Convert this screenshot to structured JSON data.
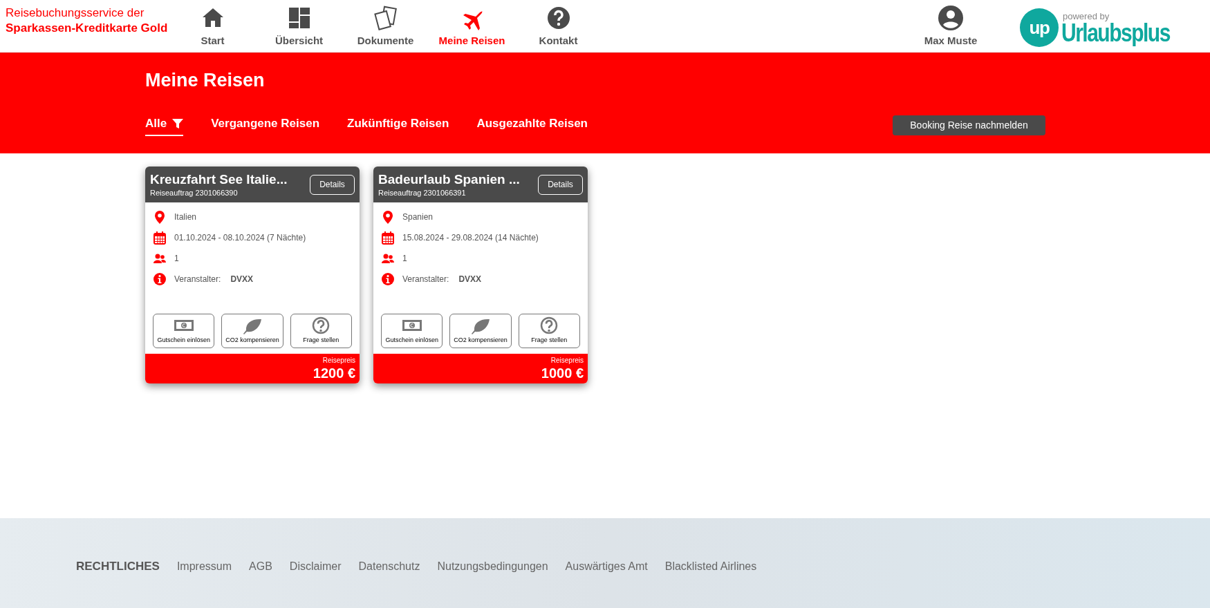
{
  "brand": {
    "line_1": "Reisebuchungsservice der",
    "line_2": "Sparkassen-Kreditkarte Gold"
  },
  "nav": [
    {
      "label": "Start",
      "kind": "house",
      "selected": false
    },
    {
      "label": "Übersicht",
      "kind": "grid",
      "selected": false
    },
    {
      "label": "Dokumente",
      "kind": "documents",
      "selected": false
    },
    {
      "label": "Meine Reisen",
      "kind": "plane",
      "selected": true
    },
    {
      "label": "Kontakt",
      "kind": "question",
      "selected": false
    }
  ],
  "user": {
    "name": "Max Muste"
  },
  "logo": {
    "powered_by": "powered by",
    "badge": "up",
    "name": "Urlaubsplus"
  },
  "page_title": "Meine Reisen",
  "filter_tabs": [
    {
      "label": "Alle",
      "filter_icon": true,
      "selected": true
    },
    {
      "label": "Vergangene Reisen",
      "filter_icon": false,
      "selected": false
    },
    {
      "label": "Zukünftige Reisen",
      "filter_icon": false,
      "selected": false
    },
    {
      "label": "Ausgezahlte Reisen",
      "filter_icon": false,
      "selected": false
    }
  ],
  "report_button": "Booking Reise nachmelden",
  "trips": [
    {
      "title": "Kreuzfahrt See Italie...",
      "order": "Reiseauftrag 2301066390",
      "details_button": "Details",
      "destination": "Italien",
      "dates": "01.10.2024 - 08.10.2024 (7 Nächte)",
      "travellers": "1",
      "organizer_label": "Veranstalter:",
      "organizer": "DVXX",
      "actions": [
        {
          "label": "Gutschein einlösen",
          "kind": "banknote"
        },
        {
          "label": "CO2 kompensieren",
          "kind": "leaf"
        },
        {
          "label": "Frage stellen",
          "kind": "question"
        }
      ],
      "price_label": "Reisepreis",
      "price": "1200 €"
    },
    {
      "title": "Badeurlaub Spanien ...",
      "order": "Reiseauftrag 2301066391",
      "details_button": "Details",
      "destination": "Spanien",
      "dates": "15.08.2024 - 29.08.2024 (14 Nächte)",
      "travellers": "1",
      "organizer_label": "Veranstalter:",
      "organizer": "DVXX",
      "actions": [
        {
          "label": "Gutschein einlösen",
          "kind": "banknote"
        },
        {
          "label": "CO2 kompensieren",
          "kind": "leaf"
        },
        {
          "label": "Frage stellen",
          "kind": "question"
        }
      ],
      "price_label": "Reisepreis",
      "price": "1000 €"
    }
  ],
  "footer": {
    "heading": "RECHTLICHES",
    "links": [
      "Impressum",
      "AGB",
      "Disclaimer",
      "Datenschutz",
      "Nutzungsbedingungen",
      "Auswärtiges Amt",
      "Blacklisted Airlines"
    ]
  }
}
